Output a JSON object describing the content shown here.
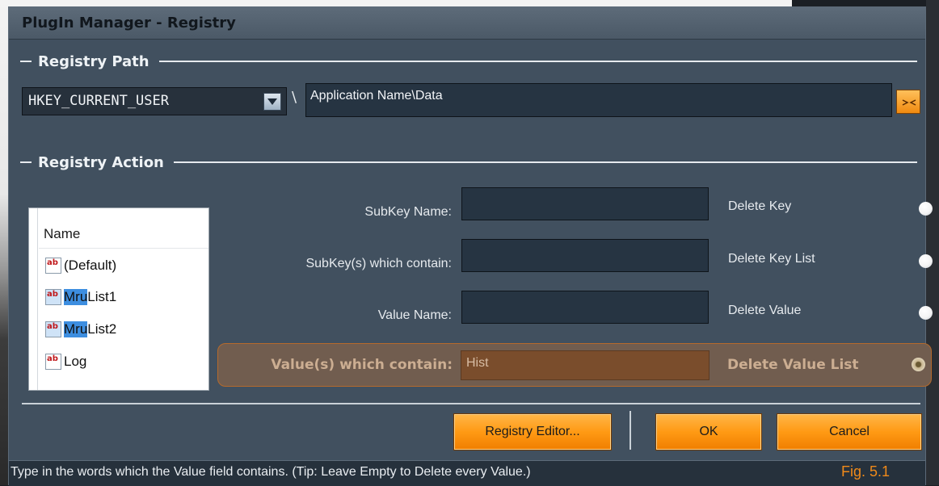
{
  "window": {
    "title": "PlugIn Manager - Registry"
  },
  "registry_path": {
    "section_label": "Registry Path",
    "hive_selected": "HKEY_CURRENT_USER",
    "separator": "\\",
    "path_value": "Application Name\\Data"
  },
  "registry_action": {
    "section_label": "Registry Action",
    "list": {
      "header": "Name",
      "items": [
        {
          "label": "(Default)",
          "highlight": ""
        },
        {
          "label": "List1",
          "highlight": "Mru"
        },
        {
          "label": "List2",
          "highlight": "Mru"
        },
        {
          "label": "Log",
          "highlight": ""
        }
      ]
    },
    "rows": [
      {
        "label": "SubKey Name:",
        "value": "",
        "action": "Delete Key",
        "selected": false
      },
      {
        "label": "SubKey(s) which contain:",
        "value": "",
        "action": "Delete Key List",
        "selected": false
      },
      {
        "label": "Value Name:",
        "value": "",
        "action": "Delete Value",
        "selected": false
      },
      {
        "label": "Value(s) which contain:",
        "value": "Hist",
        "action": "Delete Value List",
        "selected": true
      }
    ]
  },
  "buttons": {
    "registry_editor": "Registry Editor...",
    "ok": "OK",
    "cancel": "Cancel"
  },
  "status": {
    "text": "Type in the words which the Value field contains. (Tip: Leave Empty to Delete every Value.)",
    "figure_label": "Fig. 5.1"
  },
  "icons": {
    "dropdown": "chevron-down-icon",
    "collapse": "collapse-arrows-icon",
    "string_value": "reg-string-icon",
    "radio": "radio-icon"
  },
  "colors": {
    "window_bg": "#41505f",
    "field_bg": "#263442",
    "accent_orange": "#ff9a14",
    "highlight_row": "#715d4f",
    "figure_label": "#f08a1a"
  }
}
